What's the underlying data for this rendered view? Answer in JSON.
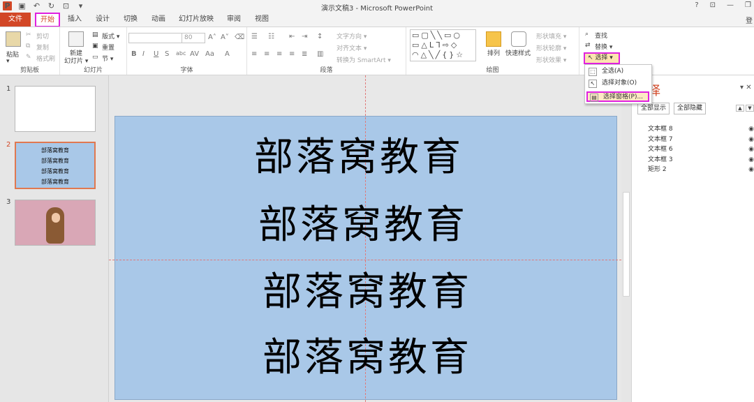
{
  "app": {
    "title": "演示文稿3 - Microsoft PowerPoint",
    "user": "登"
  },
  "window_controls": [
    "?",
    "⊡",
    "—",
    "❐"
  ],
  "tabs": [
    {
      "label": "文件"
    },
    {
      "label": "开始"
    },
    {
      "label": "插入"
    },
    {
      "label": "设计"
    },
    {
      "label": "切换"
    },
    {
      "label": "动画"
    },
    {
      "label": "幻灯片放映"
    },
    {
      "label": "审阅"
    },
    {
      "label": "视图"
    }
  ],
  "ribbon": {
    "clipboard": {
      "paste": "粘贴",
      "cut": "剪切",
      "copy": "复制",
      "format_painter": "格式刷",
      "label": "剪贴板"
    },
    "slides": {
      "new_slide": "新建",
      "new_slide2": "幻灯片 ▾",
      "layout": "版式 ▾",
      "reset": "重置",
      "section": "节 ▾",
      "label": "幻灯片"
    },
    "font": {
      "font_name": "",
      "font_size": "80",
      "label": "字体"
    },
    "paragraph": {
      "text_direction": "文字方向 ▾",
      "align_text": "对齐文本 ▾",
      "smartart": "转换为 SmartArt ▾",
      "label": "段落"
    },
    "drawing": {
      "arrange": "排列",
      "quick_styles": "快速样式",
      "fill": "形状填充 ▾",
      "outline": "形状轮廓 ▾",
      "effects": "形状效果 ▾",
      "label": "绘图"
    },
    "editing": {
      "find": "查找",
      "replace": "替换 ▾",
      "select": "选择 ▾"
    }
  },
  "select_menu": [
    {
      "label": "全选(A)"
    },
    {
      "label": "选择对象(O)"
    },
    {
      "label": "选择窗格(P)..."
    }
  ],
  "slides": [
    {
      "num": "1"
    },
    {
      "num": "2",
      "lines": [
        "部落窝教育",
        "部落窝教育",
        "部落窝教育",
        "部落窝教育"
      ]
    },
    {
      "num": "3"
    }
  ],
  "slide_text": [
    "部落窝教育",
    "部落窝教育",
    "部落窝教育",
    "部落窝教育"
  ],
  "selection_pane": {
    "title": "择",
    "show_all": "全部显示",
    "hide_all": "全部隐藏",
    "items": [
      "文本框 8",
      "文本框 7",
      "文本框 6",
      "文本框 3",
      "矩形 2"
    ]
  },
  "colors": {
    "accent": "#d24726",
    "highlight": "#e020e0",
    "slide_bg": "#a9c8e8"
  }
}
